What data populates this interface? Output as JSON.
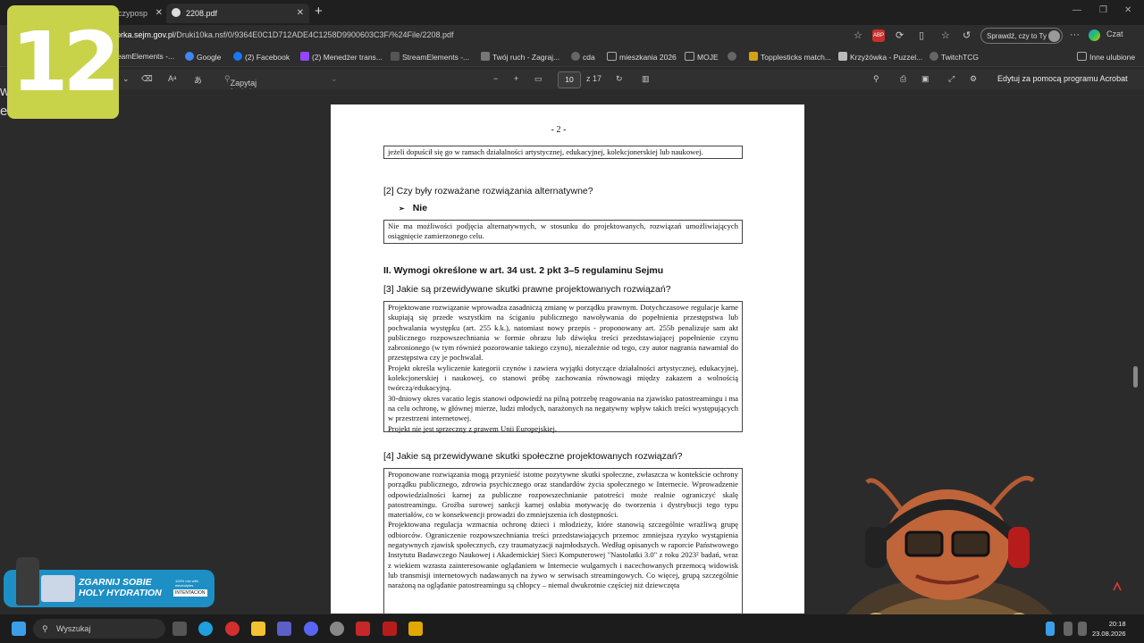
{
  "tabs": [
    {
      "label": "czyposp",
      "active": false
    },
    {
      "label": "2208.pdf",
      "active": true
    }
  ],
  "address": {
    "url_domain": "orka.sejm.gov.pl",
    "url_path": "/Druki10ka.nsf/0/9364E0C1D712ADE4C1258D9900603C3F/%24File/2208.pdf",
    "profile_button": "Sprawdź, czy to Ty",
    "copilot_label": "Czat"
  },
  "bookmarks": [
    {
      "label": "reamElements -...",
      "color": "#3a3a3a"
    },
    {
      "label": "Google",
      "color": "#4285f4"
    },
    {
      "label": "(2) Facebook",
      "color": "#1877f2"
    },
    {
      "label": "(2) Menedżer trans...",
      "color": "#9146ff"
    },
    {
      "label": "StreamElements -...",
      "color": "#3a3a3a"
    },
    {
      "label": "Twój ruch - Zagraj...",
      "color": "#555555"
    },
    {
      "label": "cda",
      "color": "#444444"
    },
    {
      "label": "mieszkania 2026",
      "color": "#444444"
    },
    {
      "label": "MOJE",
      "color": "#444444"
    },
    {
      "label": "Topplesticks match...",
      "color": "#d4a017"
    },
    {
      "label": "Krzyżówka - Puzzel...",
      "color": "#333333"
    },
    {
      "label": "TwitchTCG",
      "color": "#444444"
    },
    {
      "label": "Inne ulubione",
      "color": "#444444"
    }
  ],
  "pdf_toolbar": {
    "copilot_placeholder": "Zapytaj funkcję Copilot",
    "page_current": "10",
    "page_total": "z 17",
    "edit_acrobat": "Edytuj za pomocą programu Acrobat"
  },
  "document": {
    "page_number": "- 2 -",
    "box1": "jeżeli dopuścił się go w ramach działalności artystycznej, edukacyjnej, kolekcjonerskiej lub naukowej.",
    "q2": "[2] Czy były rozważane rozwiązania alternatywne?",
    "answer2": "Nie",
    "box2": "Nie ma możliwości podjęcia alternatywnych, w stosunku do projektowanych, rozwiązań umożliwiających osiągnięcie zamierzonego celu.",
    "section2": "II. Wymogi określone w art. 34 ust. 2 pkt 3–5 regulaminu Sejmu",
    "q3": "[3] Jakie są przewidywane skutki prawne projektowanych rozwiązań?",
    "box3": [
      "Projektowane rozwiązanie wprowadza zasadniczą zmianę w porządku prawnym. Dotychczasowe regulacje karne skupiają się przede wszystkim na ściganiu publicznego nawoływania do popełnienia przestępstwa lub pochwalania występku (art. 255 k.k.), natomiast nowy przepis - proponowany art. 255b penalizuje sam akt publicznego rozpowszechniania w formie obrazu lub dźwięku treści przedstawiającej popełnienie czynu zabronionego (w tym również pozorowanie takiego czynu), niezależnie od tego, czy autor nagrania nawamiał do przestępstwa czy je pochwalał.",
      "Projekt określa wyliczenie kategorii czynów i zawiera wyjątki dotyczące działalności artystycznej, edukacyjnej, kolekcjonerskiej i naukowej, co stanowi próbę zachowania równowagi między zakazem a wolnością twórczą/edukacyjną.",
      "30-dniowy okres vacatio legis stanowi odpowiedź na pilną potrzebę reagowania na zjawisko patostreamingu i ma na celu ochronę, w głównej mierze, ludzi młodych, narażonych na negatywny wpływ takich treści występujących w przestrzeni internetowej.",
      "Projekt nie jest sprzeczny z prawem Unii Europejskiej."
    ],
    "q4": "[4] Jakie są przewidywane skutki społeczne projektowanych rozwiązań?",
    "box4": [
      "Proponowane rozwiązania mogą przynieść istotne pozytywne skutki społeczne, zwłaszcza w kontekście ochrony porządku publicznego, zdrowia psychicznego oraz standardów życia społecznego w Internecie. Wprowadzenie odpowiedzialności karnej za publiczne rozpowszechnianie patotreści może realnie ograniczyć skalę patostreamingu. Groźba surowej sankcji karnej osłabia motywację do tworzenia i dystrybucji tego typu materiałów, co w konsekwencji prowadzi do zmniejszenia ich dostępności.",
      "Projektowana regulacja wzmacnia ochronę dzieci i młodzieży, które stanowią szczególnie wrażliwą grupę odbiorców. Ograniczenie rozpowszechniania treści przedstawiających przemoc zmniejsza ryzyko wystąpienia negatywnych zjawisk społecznych, czy traumatyzacji najmłodszych. Według opisanych w raporcie Państwowego Instytutu Badawczego Naukowej i Akademickiej Sieci Komputerowej \"Nastolatki 3.0\" z roku 2023² badań, wraz z wiekiem wzrasta zainteresowanie oglądaniem w Internecie wulgarnych i nacechowanych przemocą widowisk lub transmisji internetowych nadawanych na żywo w serwisach streamingowych. Co więcej, grupą szczególnie narażoną na oglądanie patostreamingu są chłopcy – niemal dwukrotnie częściej niż dziewczęta"
    ]
  },
  "overlays": {
    "badge": "12",
    "left_fragment": [
      "w",
      "e"
    ],
    "promo_title_1": "ZGARNIJ SOBIE",
    "promo_title_2": "HOLY HYDRATION",
    "promo_small": "100% mix with electrolytes",
    "promo_brand": "INTENTACION"
  },
  "taskbar": {
    "search": "Wyszukaj",
    "time": "20:18",
    "date": "23.08.2026"
  }
}
